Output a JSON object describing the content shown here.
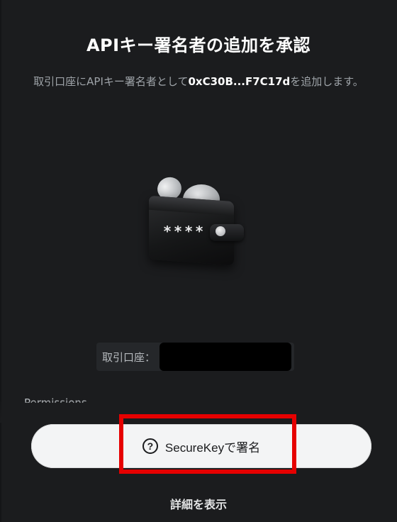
{
  "dialog": {
    "title": "APIキー署名者の追加を承認",
    "description_prefix": "取引口座にAPIキー署名者として",
    "signer_address": "0xC30B...F7C17d",
    "description_suffix": "を追加します。"
  },
  "illustration": {
    "wallet_text": "****"
  },
  "account": {
    "label": "取引口座：",
    "value": ""
  },
  "permissions": {
    "label": "Permissions"
  },
  "actions": {
    "sign_label": "SecureKeyで署名",
    "help_icon": "?",
    "details_label": "詳細を表示"
  },
  "highlight": {
    "color": "#e60000"
  }
}
